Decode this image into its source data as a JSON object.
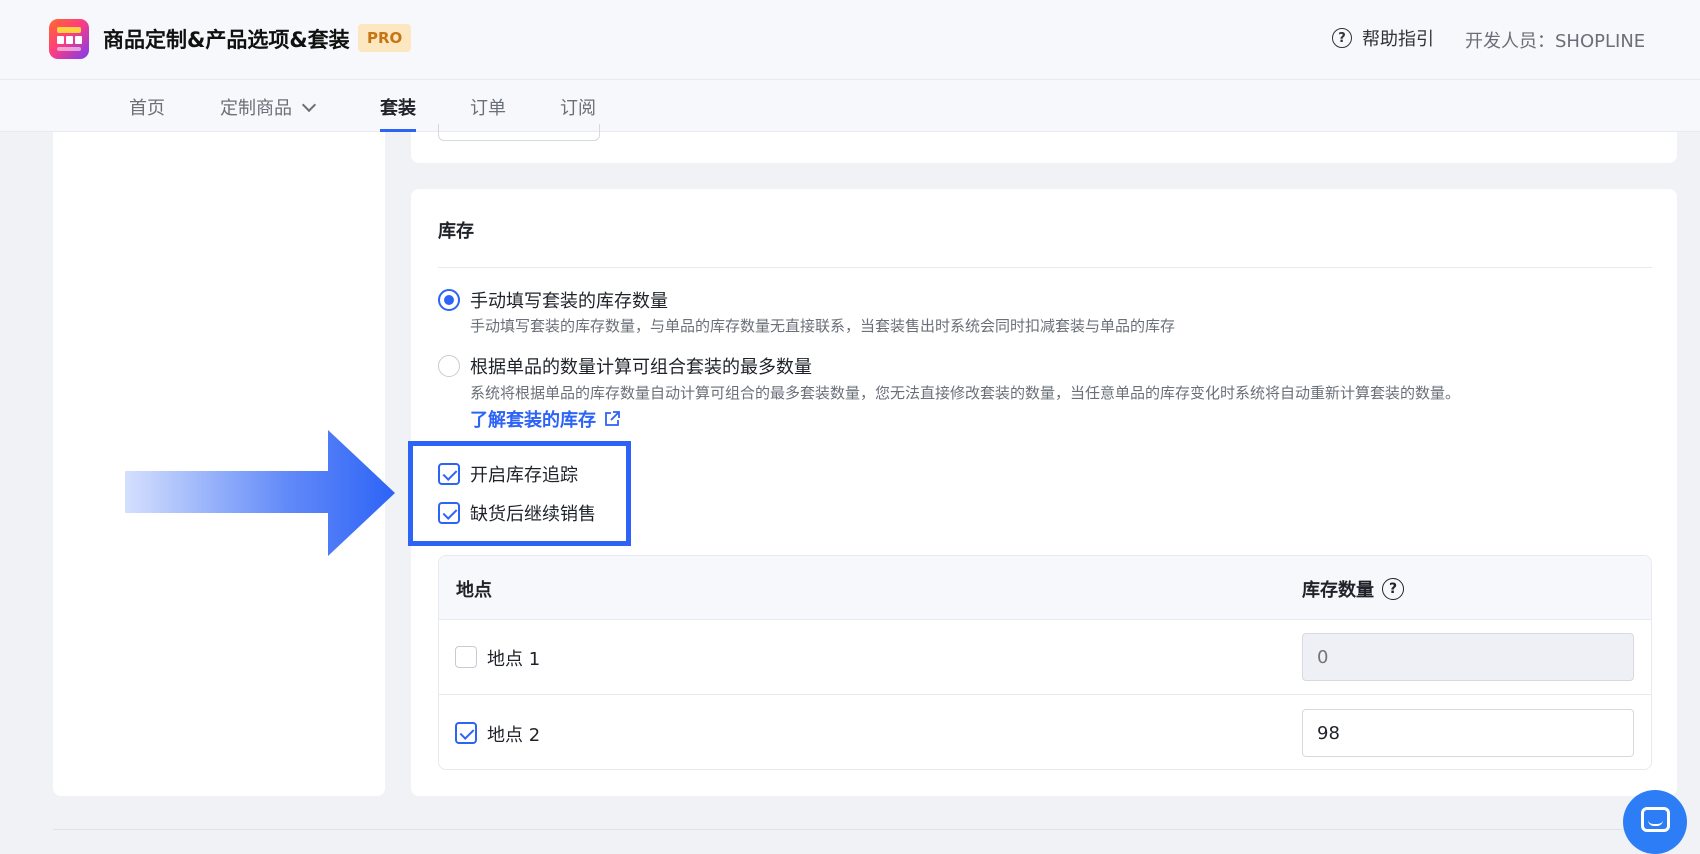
{
  "header": {
    "app_title": "商品定制&产品选项&套装",
    "badge": "PRO",
    "help_label": "帮助指引",
    "developer": "开发人员：SHOPLINE"
  },
  "nav": {
    "items": [
      {
        "label": "首页"
      },
      {
        "label": "定制商品"
      },
      {
        "label": "套装"
      },
      {
        "label": "订单"
      },
      {
        "label": "订阅"
      }
    ],
    "active": "套装"
  },
  "inventory": {
    "title": "库存",
    "option_manual": {
      "label": "手动填写套装的库存数量",
      "desc": "手动填写套装的库存数量，与单品的库存数量无直接联系，当套装售出时系统会同时扣减套装与单品的库存",
      "selected": true
    },
    "option_auto": {
      "label": "根据单品的数量计算可组合套装的最多数量",
      "desc": "系统将根据单品的库存数量自动计算可组合的最多套装数量，您无法直接修改套装的数量，当任意单品的库存变化时系统将自动重新计算套装的数量。",
      "selected": false
    },
    "learn_link": "了解套装的库存",
    "track_inventory": {
      "label": "开启库存追踪",
      "checked": true
    },
    "continue_selling": {
      "label": "缺货后继续销售",
      "checked": true
    },
    "table": {
      "col_location": "地点",
      "col_quantity": "库存数量",
      "rows": [
        {
          "name": "地点 1",
          "checked": false,
          "quantity": "0"
        },
        {
          "name": "地点 2",
          "checked": true,
          "quantity": "98"
        }
      ]
    }
  },
  "colors": {
    "accent": "#2d63f6",
    "highlight": "#2d63f6",
    "badge_bg": "#fde7c0",
    "badge_text": "#c67514"
  }
}
